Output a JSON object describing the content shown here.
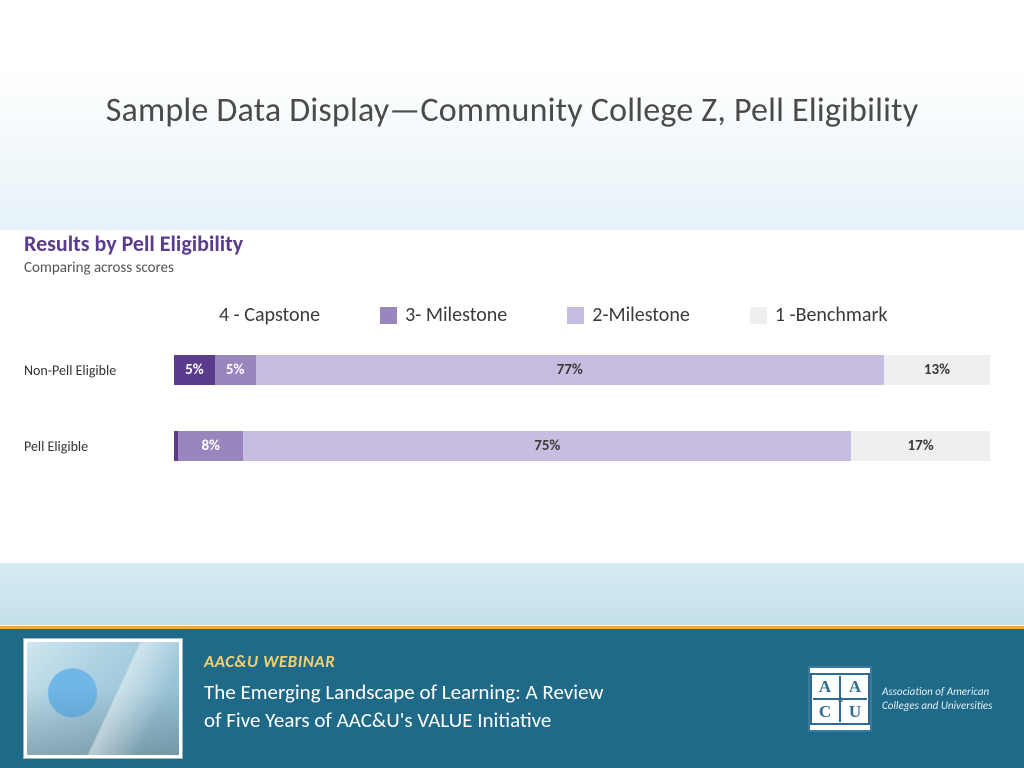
{
  "slide": {
    "title": "Sample Data Display—Community College Z, Pell Eligibility"
  },
  "chart": {
    "title": "Results by Pell Eligibility",
    "subtitle": "Comparing across scores",
    "legend": {
      "capstone": "4 - Capstone",
      "milestone3": "3- Milestone",
      "milestone2": "2-Milestone",
      "benchmark": "1 -Benchmark"
    },
    "colors": {
      "capstone": "#5b3b8c",
      "milestone3": "#9986bf",
      "milestone2": "#c7bde0",
      "benchmark": "#efefef"
    },
    "rows": {
      "nonpell": {
        "label": "Non-Pell Eligible",
        "capstone_pct": "5%",
        "milestone3_pct": "5%",
        "milestone2_pct": "77%",
        "benchmark_pct": "13%"
      },
      "pell": {
        "label": "Pell Eligible",
        "capstone_pct": "",
        "milestone3_pct": "8%",
        "milestone2_pct": "75%",
        "benchmark_pct": "17%"
      }
    }
  },
  "footer": {
    "kicker": "AAC&U WEBINAR",
    "title_line1": "The Emerging Landscape of Learning: A Review",
    "title_line2": "of Five Years of AAC&U's VALUE Initiative",
    "logo_letters": "A A C U",
    "logo_caption": "Association of American Colleges and Universities"
  },
  "chart_data": {
    "type": "bar",
    "stacked": true,
    "orientation": "horizontal",
    "title": "Results by Pell Eligibility",
    "subtitle": "Comparing across scores",
    "categories": [
      "Non-Pell Eligible",
      "Pell Eligible"
    ],
    "series": [
      {
        "name": "4 - Capstone",
        "color": "#5b3b8c",
        "values": [
          5,
          0
        ]
      },
      {
        "name": "3- Milestone",
        "color": "#9986bf",
        "values": [
          5,
          8
        ]
      },
      {
        "name": "2-Milestone",
        "color": "#c7bde0",
        "values": [
          77,
          75
        ]
      },
      {
        "name": "1 -Benchmark",
        "color": "#efefef",
        "values": [
          13,
          17
        ]
      }
    ],
    "xlabel": "",
    "ylabel": "",
    "unit": "percent",
    "xlim": [
      0,
      100
    ]
  }
}
